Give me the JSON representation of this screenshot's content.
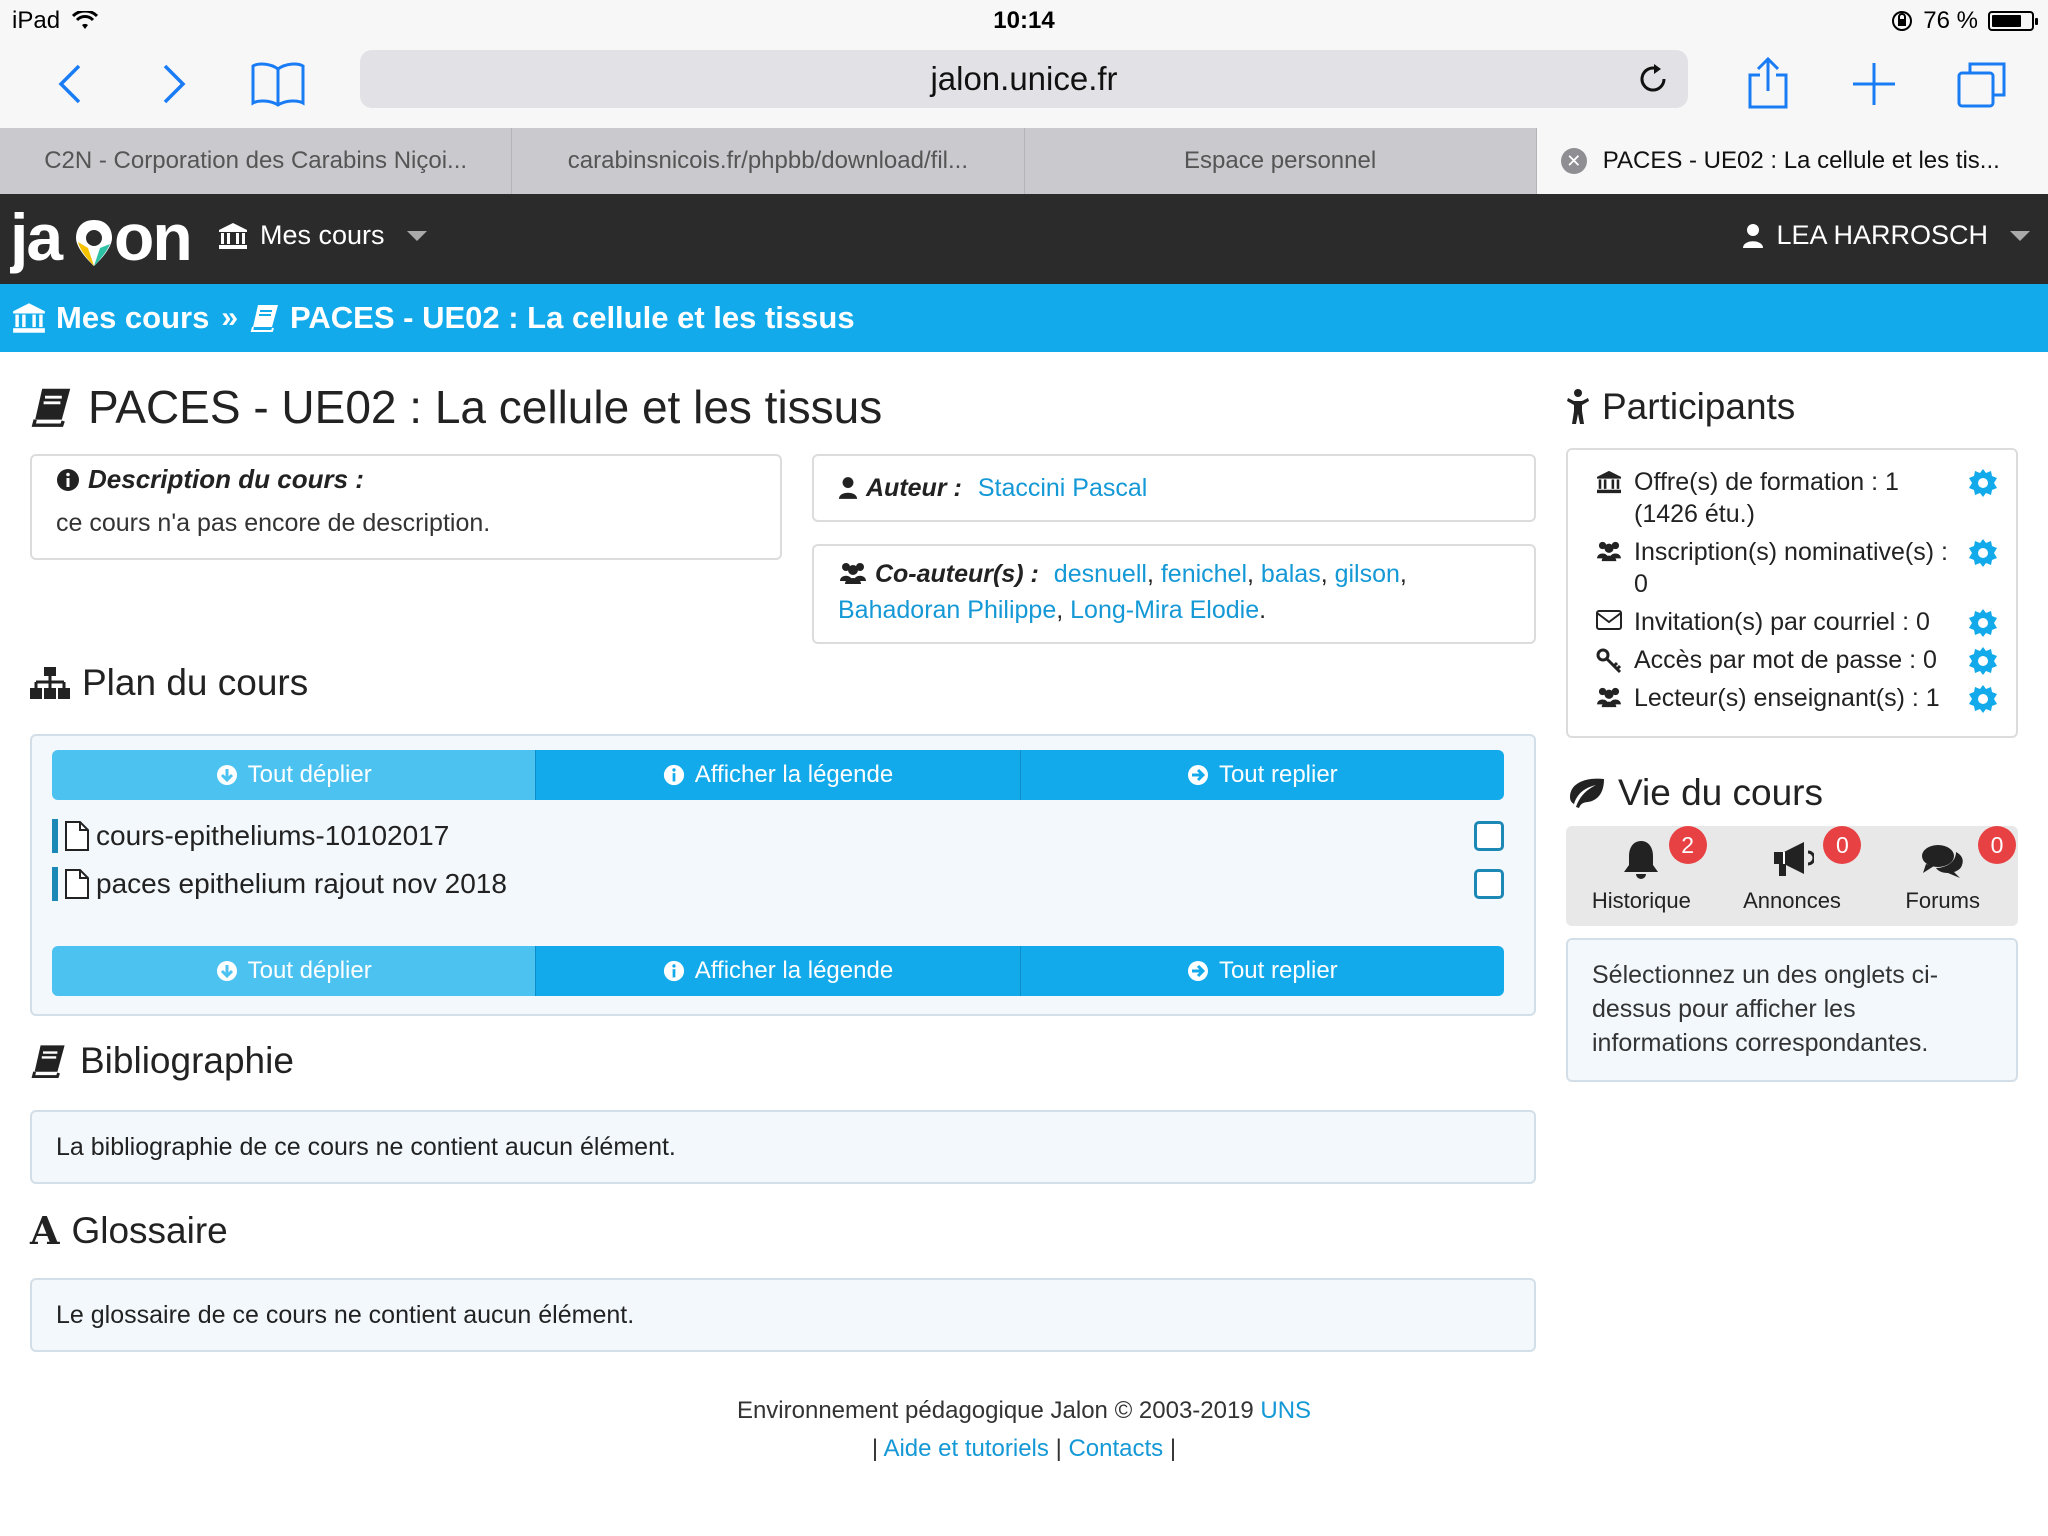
{
  "statusbar": {
    "device": "iPad",
    "time": "10:14",
    "battery": "76 %",
    "battery_level": 0.76
  },
  "browser": {
    "url": "jalon.unice.fr",
    "tabs": [
      {
        "label": "C2N - Corporation des Carabins Niçoi..."
      },
      {
        "label": "carabinsnicois.fr/phpbb/download/fil..."
      },
      {
        "label": "Espace personnel"
      },
      {
        "label": "PACES - UE02 : La cellule et les tis..."
      }
    ]
  },
  "navbar": {
    "logo": "jalon",
    "mes_cours": "Mes cours",
    "user": "LEA HARROSCH"
  },
  "breadcrumb": {
    "home": "Mes cours",
    "sep": "»",
    "current": "PACES - UE02 : La cellule et les tissus"
  },
  "course": {
    "title": "PACES - UE02 : La cellule et les tissus",
    "description_label": "Description du cours :",
    "description_text": "ce cours n'a pas encore de description.",
    "auteur_label": "Auteur :",
    "auteur": "Staccini Pascal",
    "coauteurs_label": "Co-auteur(s) :",
    "coauteurs": [
      "desnuell",
      "fenichel",
      "balas",
      "gilson",
      "Bahadoran Philippe",
      "Long-Mira Elodie"
    ],
    "comma": ",",
    "period": "."
  },
  "plan": {
    "title": "Plan du cours",
    "btn_deplier": "Tout déplier",
    "btn_legende": "Afficher la légende",
    "btn_replier": "Tout replier",
    "items": [
      "cours-epitheliums-10102017",
      "paces epithelium rajout nov 2018"
    ]
  },
  "bibliographie": {
    "title": "Bibliographie",
    "text": "La bibliographie de ce cours ne contient aucun élément."
  },
  "glossaire": {
    "title": "Glossaire",
    "text": "Le glossaire de ce cours ne contient aucun élément."
  },
  "participants": {
    "title": "Participants",
    "rows": [
      {
        "label": "Offre(s) de formation : 1 (1426 étu.)"
      },
      {
        "label": "Inscription(s) nominative(s) : 0"
      },
      {
        "label": "Invitation(s) par courriel : 0"
      },
      {
        "label": "Accès par mot de passe : 0"
      },
      {
        "label": "Lecteur(s) enseignant(s) : 1"
      }
    ]
  },
  "vie": {
    "title": "Vie du cours",
    "tabs": [
      {
        "label": "Historique",
        "badge": "2"
      },
      {
        "label": "Annonces",
        "badge": "0"
      },
      {
        "label": "Forums",
        "badge": "0"
      }
    ],
    "info": "Sélectionnez un des onglets ci-dessus pour afficher les informations correspondantes."
  },
  "footer": {
    "line1": "Environnement pédagogique Jalon © 2003-2019",
    "uns": "UNS",
    "bar": "|",
    "aide": "Aide et tutoriels",
    "contacts": "Contacts"
  },
  "colors": {
    "accent": "#12aaeb",
    "navbar": "#2b2b2b",
    "link": "#1499d6",
    "badge": "#e84143"
  }
}
